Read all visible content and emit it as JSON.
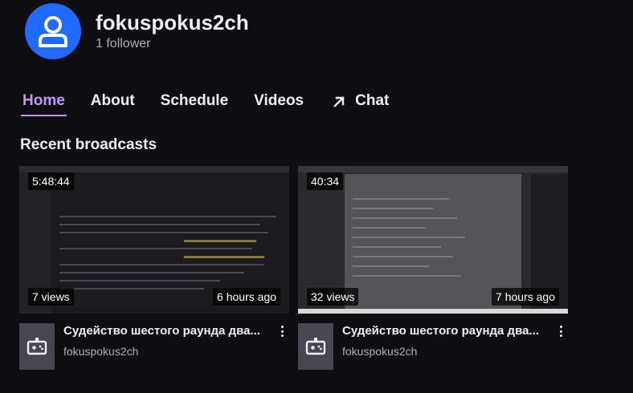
{
  "channel": {
    "name": "fokuspokus2ch",
    "followers": "1 follower",
    "avatar_icon": "user-icon",
    "avatar_color": "#1f69ff"
  },
  "tabs": [
    {
      "label": "Home",
      "active": true
    },
    {
      "label": "About",
      "active": false
    },
    {
      "label": "Schedule",
      "active": false
    },
    {
      "label": "Videos",
      "active": false
    },
    {
      "label": "Chat",
      "active": false,
      "icon": "external-arrow-icon"
    }
  ],
  "accent_color": "#bf94ff",
  "section_title": "Recent broadcasts",
  "broadcasts": [
    {
      "duration": "5:48:44",
      "views": "7 views",
      "age": "6 hours ago",
      "title": "Судейство шестого раунда два...",
      "owner": "fokuspokus2ch",
      "category_icon": "gamepad-icon"
    },
    {
      "duration": "40:34",
      "views": "32 views",
      "age": "7 hours ago",
      "title": "Судейство шестого раунда два...",
      "owner": "fokuspokus2ch",
      "category_icon": "gamepad-icon"
    }
  ]
}
